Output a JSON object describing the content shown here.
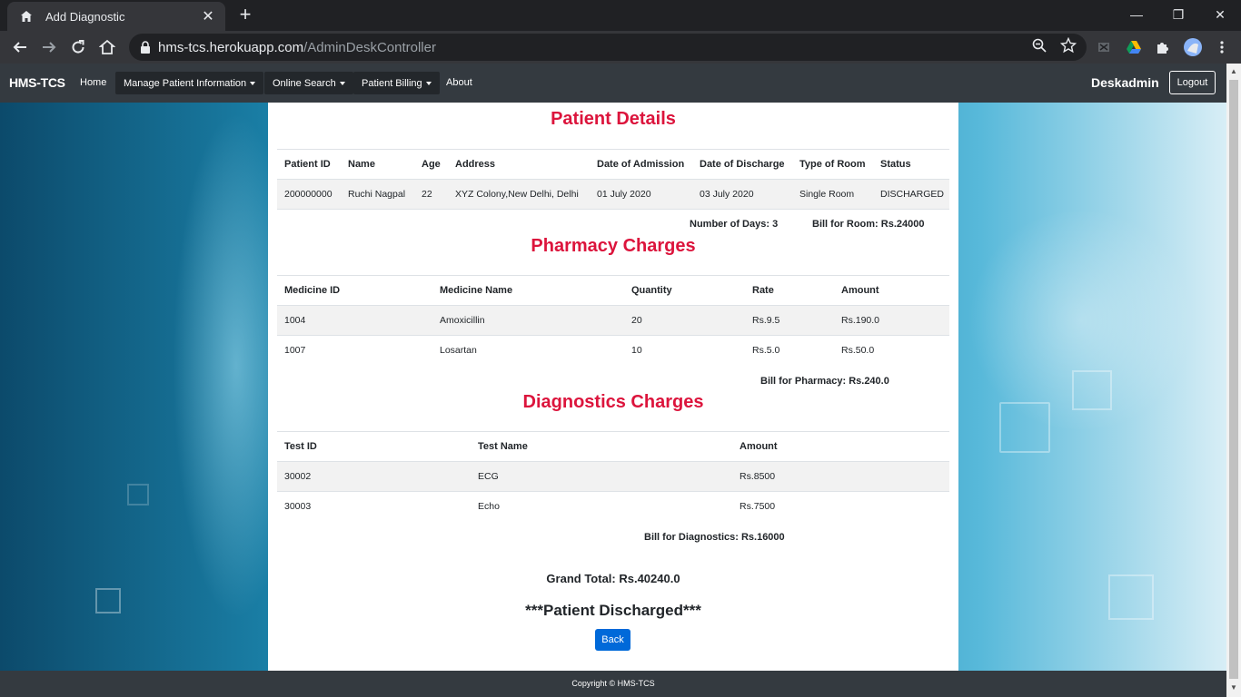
{
  "browser": {
    "tab_title": "Add Diagnostic",
    "url_host": "hms-tcs.herokuapp.com",
    "url_path": "/AdminDeskController"
  },
  "navbar": {
    "brand": "HMS-TCS",
    "home": "Home",
    "manage": "Manage Patient Information",
    "search": "Online Search",
    "billing": "Patient Billing",
    "about": "About",
    "user": "Deskadmin",
    "logout": "Logout"
  },
  "patient": {
    "heading": "Patient Details",
    "headers": [
      "Patient ID",
      "Name",
      "Age",
      "Address",
      "Date of Admission",
      "Date of Discharge",
      "Type of Room",
      "Status"
    ],
    "row": [
      "200000000",
      "Ruchi Nagpal",
      "22",
      "XYZ Colony,New Delhi, Delhi",
      "01 July 2020",
      "03 July 2020",
      "Single Room",
      "DISCHARGED"
    ],
    "days": "Number of Days: 3",
    "room_bill": "Bill for Room: Rs.24000"
  },
  "pharmacy": {
    "heading": "Pharmacy Charges",
    "headers": [
      "Medicine ID",
      "Medicine Name",
      "Quantity",
      "Rate",
      "Amount"
    ],
    "rows": [
      [
        "1004",
        "Amoxicillin",
        "20",
        "Rs.9.5",
        "Rs.190.0"
      ],
      [
        "1007",
        "Losartan",
        "10",
        "Rs.5.0",
        "Rs.50.0"
      ]
    ],
    "bill": "Bill for Pharmacy: Rs.240.0"
  },
  "diagnostics": {
    "heading": "Diagnostics Charges",
    "headers": [
      "Test ID",
      "Test Name",
      "Amount"
    ],
    "rows": [
      [
        "30002",
        "ECG",
        "Rs.8500"
      ],
      [
        "30003",
        "Echo",
        "Rs.7500"
      ]
    ],
    "bill": "Bill for Diagnostics: Rs.16000"
  },
  "grand_total": "Grand Total: Rs.40240.0",
  "discharged": "***Patient Discharged***",
  "back": "Back",
  "footer": "Copyright © HMS-TCS",
  "colors": {
    "heading": "#dc143c",
    "navbar": "#343a40",
    "back_button": "#0069d9"
  }
}
